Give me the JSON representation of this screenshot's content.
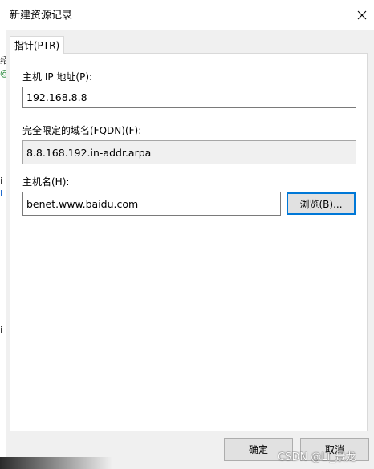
{
  "window": {
    "title": "新建资源记录"
  },
  "tabs": [
    {
      "label": "指针(PTR)",
      "active": true
    }
  ],
  "form": {
    "host_ip": {
      "label": "主机 IP 地址(P):",
      "value": "192.168.8.8"
    },
    "fqdn": {
      "label": "完全限定的域名(FQDN)(F):",
      "value": "8.8.168.192.in-addr.arpa"
    },
    "host_name": {
      "label": "主机名(H):",
      "value": "benet.www.baidu.com"
    },
    "browse_label": "浏览(B)..."
  },
  "footer": {
    "ok_label": "确定",
    "cancel_label": "取消"
  },
  "watermark": "CSDN @Ll_景龙",
  "colors": {
    "accent": "#0078d7",
    "button_bg": "#e1e1e1",
    "panel_bg": "#ffffff",
    "dialog_bg": "#f0f0f0"
  },
  "icons": {
    "close": "close-icon"
  }
}
